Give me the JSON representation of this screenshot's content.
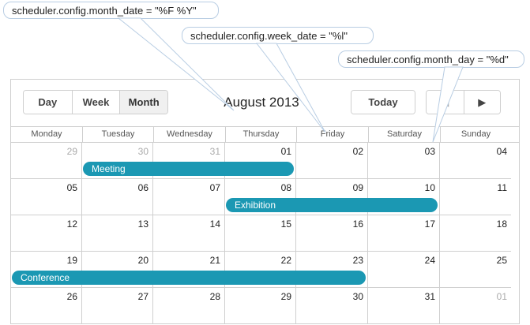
{
  "callouts": {
    "month_date": "scheduler.config.month_date = \"%F %Y\"",
    "week_date": "scheduler.config.week_date = \"%l\"",
    "month_day": "scheduler.config.month_day = \"%d\""
  },
  "toolbar": {
    "tabs": [
      "Day",
      "Week",
      "Month"
    ],
    "active_tab": "Month",
    "title": "August 2013",
    "today_label": "Today"
  },
  "weekdays": [
    "Monday",
    "Tuesday",
    "Wednesday",
    "Thursday",
    "Friday",
    "Saturday",
    "Sunday"
  ],
  "weeks": [
    [
      "29",
      "30",
      "31",
      "01",
      "02",
      "03",
      "04"
    ],
    [
      "05",
      "06",
      "07",
      "08",
      "09",
      "10",
      "11"
    ],
    [
      "12",
      "13",
      "14",
      "15",
      "16",
      "17",
      "18"
    ],
    [
      "19",
      "20",
      "21",
      "22",
      "23",
      "24",
      "25"
    ],
    [
      "26",
      "27",
      "28",
      "29",
      "30",
      "31",
      "01"
    ]
  ],
  "events": {
    "meeting": "Meeting",
    "exhibition": "Exhibition",
    "conference": "Conference"
  },
  "colors": {
    "event": "#1b98b3",
    "callout_border": "#b8cde3"
  }
}
